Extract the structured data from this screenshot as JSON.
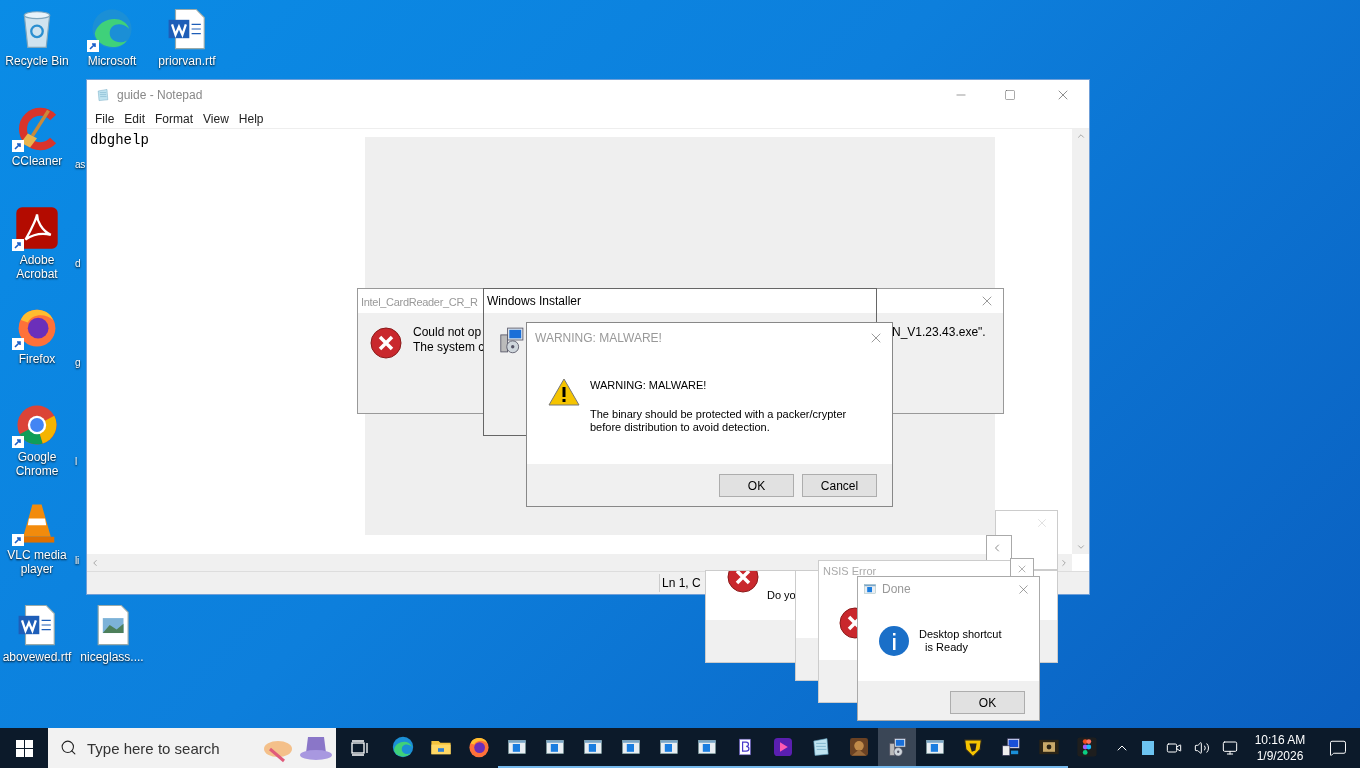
{
  "desktop_icons": [
    {
      "kind": "recycle",
      "label": "Recycle Bin",
      "shortcut": false
    },
    {
      "kind": "edge",
      "label": "Microsoft",
      "shortcut": true
    },
    {
      "kind": "word",
      "label": "priorvan.rtf",
      "shortcut": false
    },
    {
      "kind": "ccleaner",
      "label": "CCleaner",
      "shortcut": true
    },
    {
      "kind": "acrobat",
      "label": "Adobe Acrobat",
      "shortcut": true
    },
    {
      "kind": "firefox",
      "label": "Firefox",
      "shortcut": true
    },
    {
      "kind": "chrome",
      "label": "Google Chrome",
      "shortcut": true
    },
    {
      "kind": "vlc",
      "label": "VLC media player",
      "shortcut": true
    },
    {
      "kind": "word",
      "label": "abovewed.rtf",
      "shortcut": false
    },
    {
      "kind": "image",
      "label": "niceglass....",
      "shortcut": false
    }
  ],
  "hidden_labels": [
    "as",
    "d",
    "g",
    "l",
    "li"
  ],
  "notepad": {
    "title": "guide - Notepad",
    "menu": [
      "File",
      "Edit",
      "Format",
      "View",
      "Help"
    ],
    "text": "dbghelp",
    "status": "Ln 1, C"
  },
  "cardreader_dialog": {
    "title": "Intel_CardReader_CR_R",
    "line_1": "Could not op",
    "line_2": "The system c",
    "line_1_end": "N_V1.23.43.exe\"."
  },
  "installer_dialog": {
    "title": "Windows Installer"
  },
  "warning_dialog": {
    "title": "WARNING: MALWARE!",
    "heading": "WARNING: MALWARE!",
    "body": [
      "The binary should be protected with a packer/crypter",
      "before distribution to avoid detection."
    ],
    "buttons": [
      "OK",
      "Cancel"
    ]
  },
  "error_dialog": {
    "text": "Do yo"
  },
  "nsis_dialog": {
    "title": "NSIS Error"
  },
  "done_dialog": {
    "title": "Done",
    "lines": [
      "Desktop shortcut",
      "  is Ready"
    ],
    "button": "OK"
  },
  "taskbar": {
    "search_placeholder": "Type here to search",
    "apps": [
      {
        "kind": "edge",
        "running": false,
        "selected": false
      },
      {
        "kind": "folder",
        "running": false,
        "selected": false
      },
      {
        "kind": "firefox",
        "running": false,
        "selected": false
      },
      {
        "kind": "window",
        "running": true,
        "selected": false
      },
      {
        "kind": "window",
        "running": true,
        "selected": false
      },
      {
        "kind": "window",
        "running": true,
        "selected": false
      },
      {
        "kind": "window",
        "running": true,
        "selected": false
      },
      {
        "kind": "window",
        "running": true,
        "selected": false
      },
      {
        "kind": "window",
        "running": true,
        "selected": false
      },
      {
        "kind": "bitcoin",
        "running": true,
        "selected": false
      },
      {
        "kind": "media",
        "running": true,
        "selected": false
      },
      {
        "kind": "notepad",
        "running": true,
        "selected": false
      },
      {
        "kind": "game",
        "running": true,
        "selected": false
      },
      {
        "kind": "installer",
        "running": true,
        "selected": true
      },
      {
        "kind": "window",
        "running": true,
        "selected": false
      },
      {
        "kind": "shield",
        "running": true,
        "selected": false
      },
      {
        "kind": "computer",
        "running": true,
        "selected": false
      },
      {
        "kind": "film",
        "running": true,
        "selected": false
      },
      {
        "kind": "figma",
        "running": false,
        "selected": false
      }
    ],
    "time": "10:16 AM",
    "date": "1/9/2026"
  }
}
